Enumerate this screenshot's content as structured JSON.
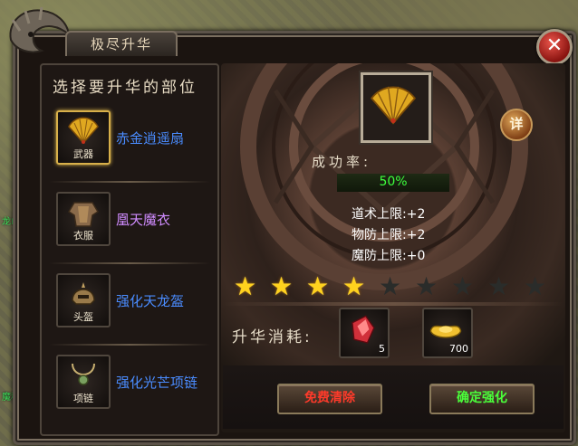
{
  "window": {
    "title": "极尽升华",
    "close_label": "✕"
  },
  "map_labels": [
    "龙山",
    "魔秘"
  ],
  "left": {
    "heading": "选择要升华的部位",
    "items": [
      {
        "slot_label": "武器",
        "name": "赤金逍遥扇",
        "name_color": "#4a8cff",
        "selected": true,
        "icon": "golden-fan-icon"
      },
      {
        "slot_label": "衣服",
        "name": "凰天魔衣",
        "name_color": "#d08cff",
        "selected": false,
        "icon": "armor-icon"
      },
      {
        "slot_label": "头盔",
        "name": "强化天龙盔",
        "name_color": "#4a8cff",
        "selected": false,
        "icon": "helmet-icon"
      },
      {
        "slot_label": "项链",
        "name": "强化光芒项链",
        "name_color": "#4a8cff",
        "selected": false,
        "icon": "necklace-icon"
      }
    ]
  },
  "right": {
    "detail_label": "详",
    "success_rate_label": "成功率:",
    "success_rate_value": "50%",
    "stats": [
      "道术上限:+2",
      "物防上限:+2",
      "魔防上限:+0"
    ],
    "stars_filled": 4,
    "stars_total": 9,
    "cost_label": "升华消耗:",
    "costs": [
      {
        "count": "5",
        "icon": "red-crystal-icon"
      },
      {
        "count": "700",
        "icon": "gold-ingot-icon"
      }
    ],
    "free_clear_label": "免费清除",
    "confirm_label": "确定强化"
  },
  "colors": {
    "free_clear_text": "#ff3a2a",
    "confirm_text": "#4aff3a",
    "star_on": "#ffd21e",
    "rate_text": "#3dff3d"
  }
}
